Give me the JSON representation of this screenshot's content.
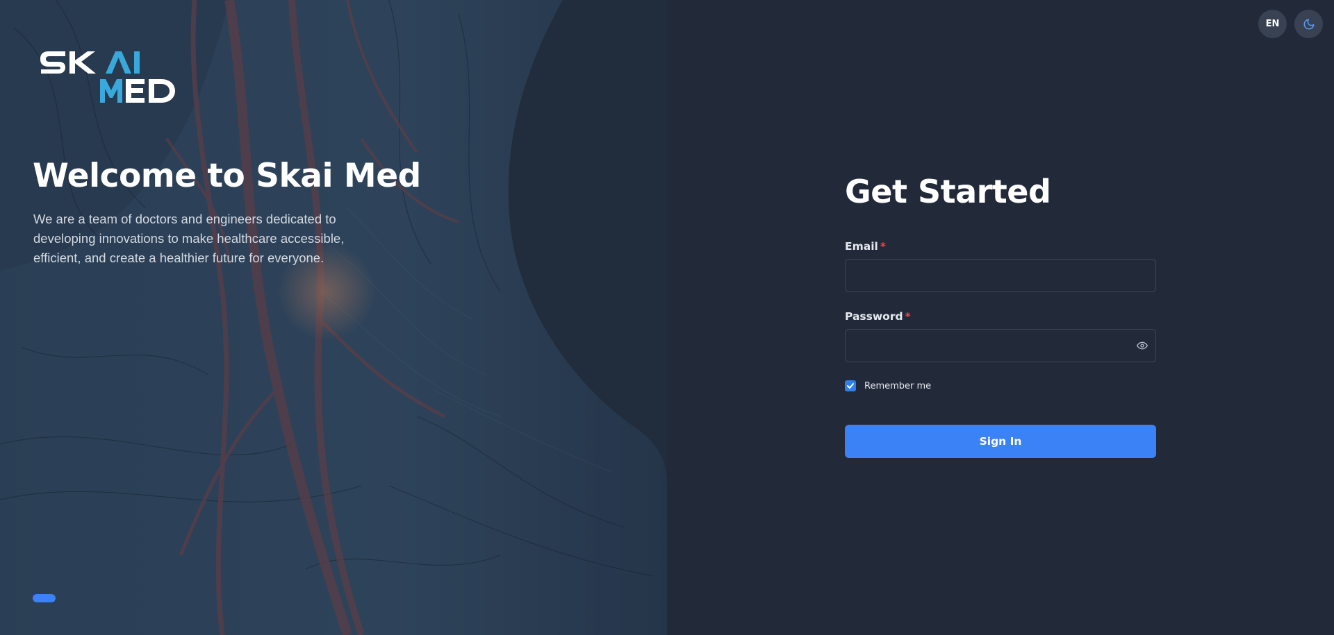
{
  "brand": {
    "logo_text_line1": "SKAI",
    "logo_text_line2": "MED",
    "accent_color": "#3b82f6",
    "logo_accent_color": "#39a9dc"
  },
  "hero": {
    "title": "Welcome to Skai Med",
    "description": "We are a team of doctors and engineers dedicated to developing innovations to make healthcare accessible, efficient, and create a healthier future for everyone.",
    "carousel_active_index": 0
  },
  "top_controls": {
    "language": "EN",
    "theme_icon": "moon-icon"
  },
  "form": {
    "title": "Get Started",
    "email_label": "Email",
    "email_value": "",
    "password_label": "Password",
    "password_value": "",
    "required_mark": "*",
    "password_icon": "eye-icon",
    "remember_label": "Remember me",
    "remember_checked": true,
    "submit_label": "Sign In"
  }
}
